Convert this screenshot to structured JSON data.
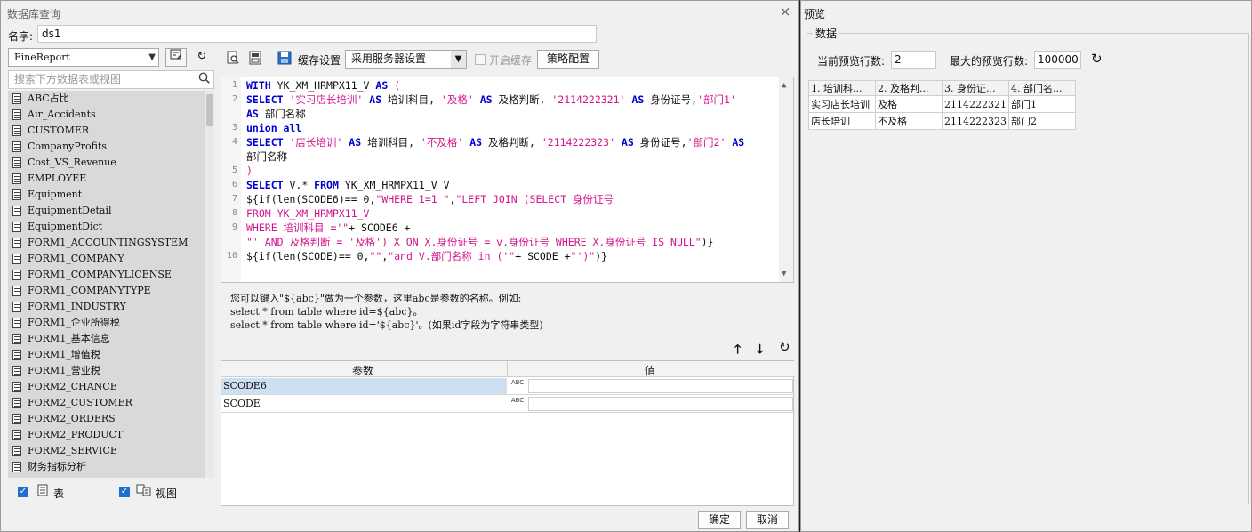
{
  "dialog": {
    "title": "数据库查询",
    "name_label": "名字:",
    "name_value": "ds1",
    "close": "×"
  },
  "left": {
    "connection": "FineReport",
    "search_placeholder": "搜索下方数据表或视图",
    "tables": [
      "ABC占比",
      "Air_Accidents",
      "CUSTOMER",
      "CompanyProfits",
      "Cost_VS_Revenue",
      "EMPLOYEE",
      "Equipment",
      "EquipmentDetail",
      "EquipmentDict",
      "FORM1_ACCOUNTINGSYSTEM",
      "FORM1_COMPANY",
      "FORM1_COMPANYLICENSE",
      "FORM1_COMPANYTYPE",
      "FORM1_INDUSTRY",
      "FORM1_企业所得税",
      "FORM1_基本信息",
      "FORM1_增值税",
      "FORM1_营业税",
      "FORM2_CHANCE",
      "FORM2_CUSTOMER",
      "FORM2_ORDERS",
      "FORM2_PRODUCT",
      "FORM2_SERVICE",
      "财务指标分析"
    ],
    "check_table": "表",
    "check_view": "视图"
  },
  "toolbar": {
    "cache_label": "缓存设置",
    "cache_option": "采用服务器设置",
    "enable_cache": "开启缓存",
    "policy_button": "策略配置"
  },
  "hint": {
    "line1": "您可以键入\"${abc}\"做为一个参数，这里abc是参数的名称。例如:",
    "line2": "select * from table where id=${abc}。",
    "line3": "select * from table where id='${abc}'。(如果id字段为字符串类型)"
  },
  "params": {
    "header_name": "参数",
    "header_value": "值",
    "rows": [
      {
        "name": "SCODE6",
        "type": "ABC"
      },
      {
        "name": "SCODE",
        "type": "ABC"
      }
    ]
  },
  "footer": {
    "ok": "确定",
    "cancel": "取消"
  },
  "preview": {
    "title": "预览",
    "group_title": "数据",
    "current_rows_label": "当前预览行数:",
    "current_rows": "2",
    "max_rows_label": "最大的预览行数:",
    "max_rows": "100000",
    "columns": [
      "1. 培训科...",
      "2. 及格判...",
      "3. 身份证...",
      "4. 部门名..."
    ],
    "rows": [
      [
        "实习店长培训",
        "及格",
        "2114222321",
        "部门1"
      ],
      [
        "店长培训",
        "不及格",
        "2114222323",
        "部门2"
      ]
    ]
  },
  "colors": {
    "keyword": "#0000d0",
    "string": "#d4148c",
    "highlight_line": "#fbfbc8",
    "selected_row": "#cddff0",
    "checkbox": "#1e6fd0"
  }
}
